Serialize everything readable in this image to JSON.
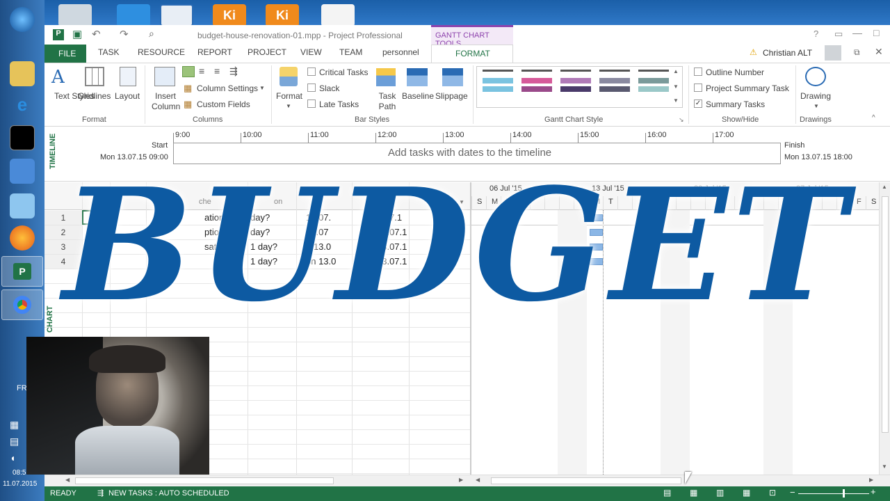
{
  "window": {
    "title": "budget-house-renovation-01.mpp - Project Professional",
    "contextual_tab": "GANTT CHART TOOLS"
  },
  "tabs": [
    "FILE",
    "TASK",
    "RESOURCE",
    "REPORT",
    "PROJECT",
    "VIEW",
    "TEAM",
    "personnel",
    "FORMAT"
  ],
  "user": "Christian ALT",
  "ribbon": {
    "format_group": {
      "text_styles": "Text Styles",
      "gridlines": "Gridlines",
      "layout": "Layout",
      "label": "Format"
    },
    "columns_group": {
      "insert_column": "Insert Column",
      "column_settings": "Column Settings",
      "custom_fields": "Custom Fields",
      "label": "Columns"
    },
    "bar_styles_group": {
      "format": "Format",
      "critical_tasks": "Critical Tasks",
      "slack": "Slack",
      "late_tasks": "Late Tasks",
      "task_path": "Task Path",
      "baseline": "Baseline",
      "slippage": "Slippage",
      "label": "Bar Styles"
    },
    "gantt_style_label": "Gantt Chart Style",
    "show_hide": {
      "outline_number": "Outline Number",
      "project_summary_task": "Project Summary Task",
      "summary_tasks": "Summary Tasks",
      "label": "Show/Hide"
    },
    "drawings": {
      "drawing": "Drawing",
      "label": "Drawings"
    }
  },
  "timeline": {
    "side_label": "TIMELINE",
    "start_label": "Start",
    "start_date": "Mon 13.07.15 09:00",
    "finish_label": "Finish",
    "finish_date": "Mon 13.07.15 18:00",
    "hours": [
      "9:00",
      "10:00",
      "11:00",
      "12:00",
      "13:00",
      "14:00",
      "15:00",
      "16:00",
      "17:00"
    ],
    "placeholder": "Add tasks with dates to the timeline"
  },
  "grid": {
    "side_label": "CHART",
    "header_partial": {
      "sched": "che",
      "duration": "on",
      "predecessors": "essor"
    },
    "row_numbers": [
      "1",
      "2",
      "3",
      "4"
    ],
    "rows": [
      {
        "name": "ation",
        "duration": "day?",
        "start": "13.07.",
        "finish": "3.07.1"
      },
      {
        "name": "ption",
        "duration": "day?",
        "start": "13.07",
        "finish": "13.07.1"
      },
      {
        "name": "sation",
        "duration": "1 day?",
        "start": "n 13.0",
        "finish": "13.07.1"
      },
      {
        "name": "",
        "duration": "1 day?",
        "start": "on 13.0",
        "finish": "13.07.1"
      }
    ]
  },
  "gantt": {
    "weeks": [
      "06 Jul '15",
      "13 Jul '15",
      "20 Jul '15",
      "27 Jul '15"
    ],
    "days_left": [
      "S",
      "M",
      "T"
    ],
    "days_mid": [
      "M",
      "T"
    ],
    "days_right": [
      "F",
      "S"
    ]
  },
  "overlay_text": "BUDGET",
  "taskbar": {
    "lang": "FR",
    "time": "08:5",
    "date": "11.07.2015"
  },
  "status": {
    "ready": "READY",
    "new_tasks": "NEW TASKS : AUTO SCHEDULED"
  },
  "colors": {
    "accent": "#217346",
    "budget_blue": "#0d5aa2",
    "contextual": "#8e44ad"
  }
}
